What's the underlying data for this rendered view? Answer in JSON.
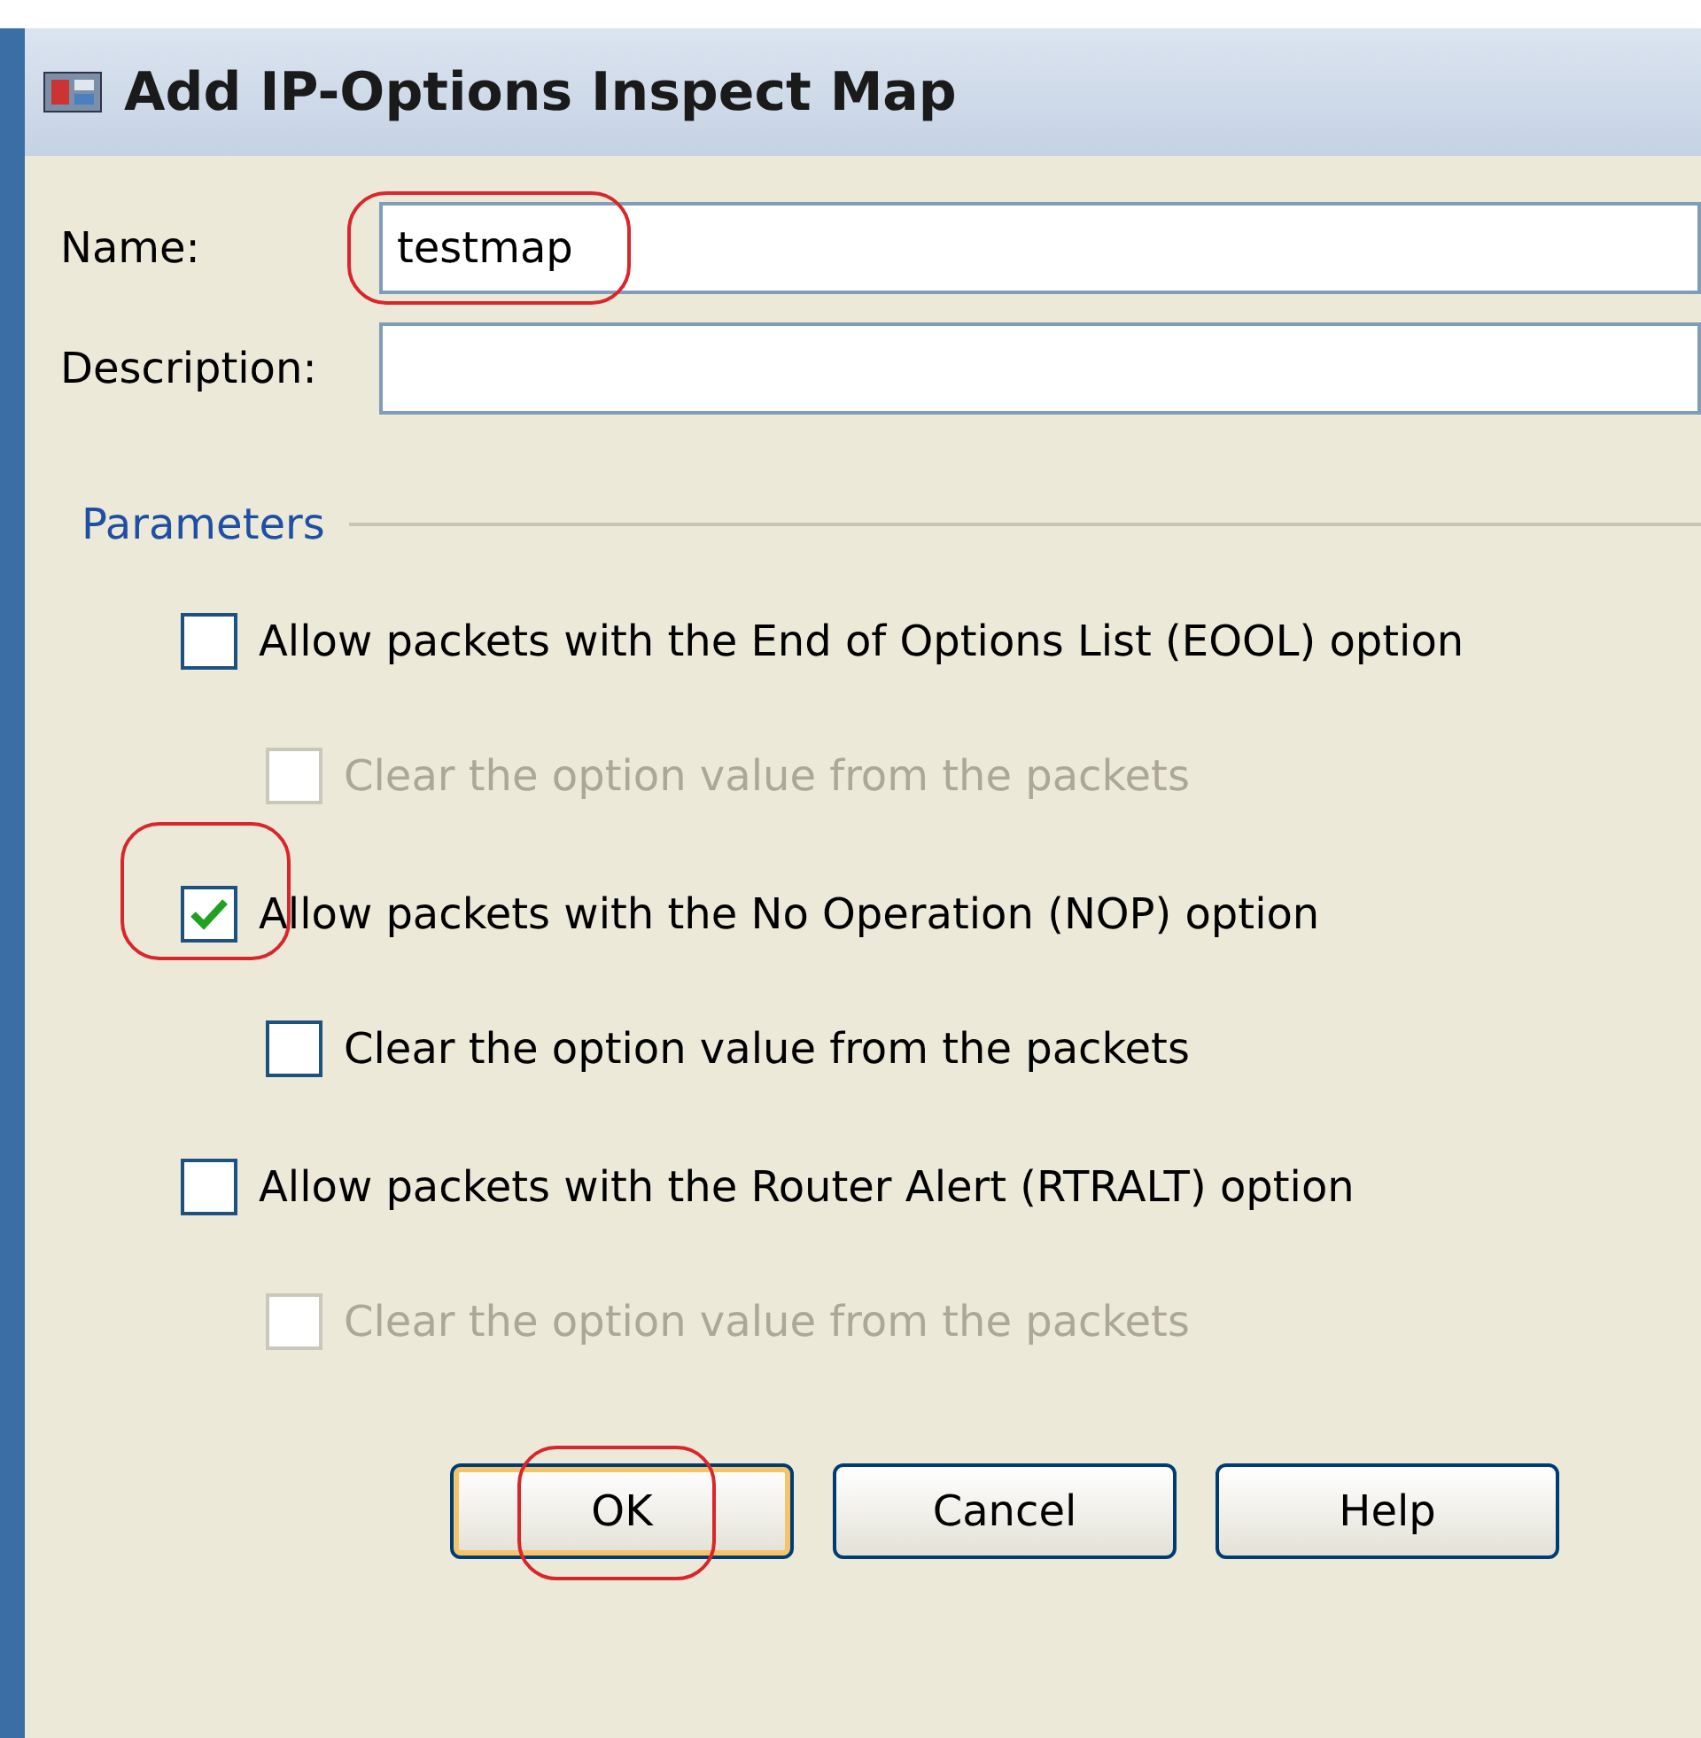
{
  "window": {
    "title": "Add IP-Options Inspect Map"
  },
  "fields": [
    {
      "label": "Name:",
      "value": "testmap",
      "highlighted": true
    },
    {
      "label": "Description:"
    }
  ],
  "parameters": {
    "title": "Parameters",
    "options": [
      {
        "label": "Allow packets with the End of Options List (EOOL) option",
        "checked": false,
        "disabled": false,
        "children": [
          {
            "label": "Clear the option value from the packets",
            "checked": false,
            "disabled": true
          }
        ]
      },
      {
        "label": "Allow packets with the No Operation (NOP) option",
        "checked": true,
        "disabled": false,
        "highlighted": true,
        "children": [
          {
            "label": "Clear the option value from the packets",
            "checked": false,
            "disabled": false
          }
        ]
      },
      {
        "label": "Allow packets with the Router Alert (RTRALT) option",
        "checked": false,
        "disabled": false,
        "children": [
          {
            "label": "Clear the option value from the packets",
            "checked": false,
            "disabled": true
          }
        ]
      }
    ]
  },
  "buttons": [
    {
      "label": "OK",
      "highlighted": true
    },
    {
      "label": "Cancel"
    },
    {
      "label": "Help"
    }
  ]
}
